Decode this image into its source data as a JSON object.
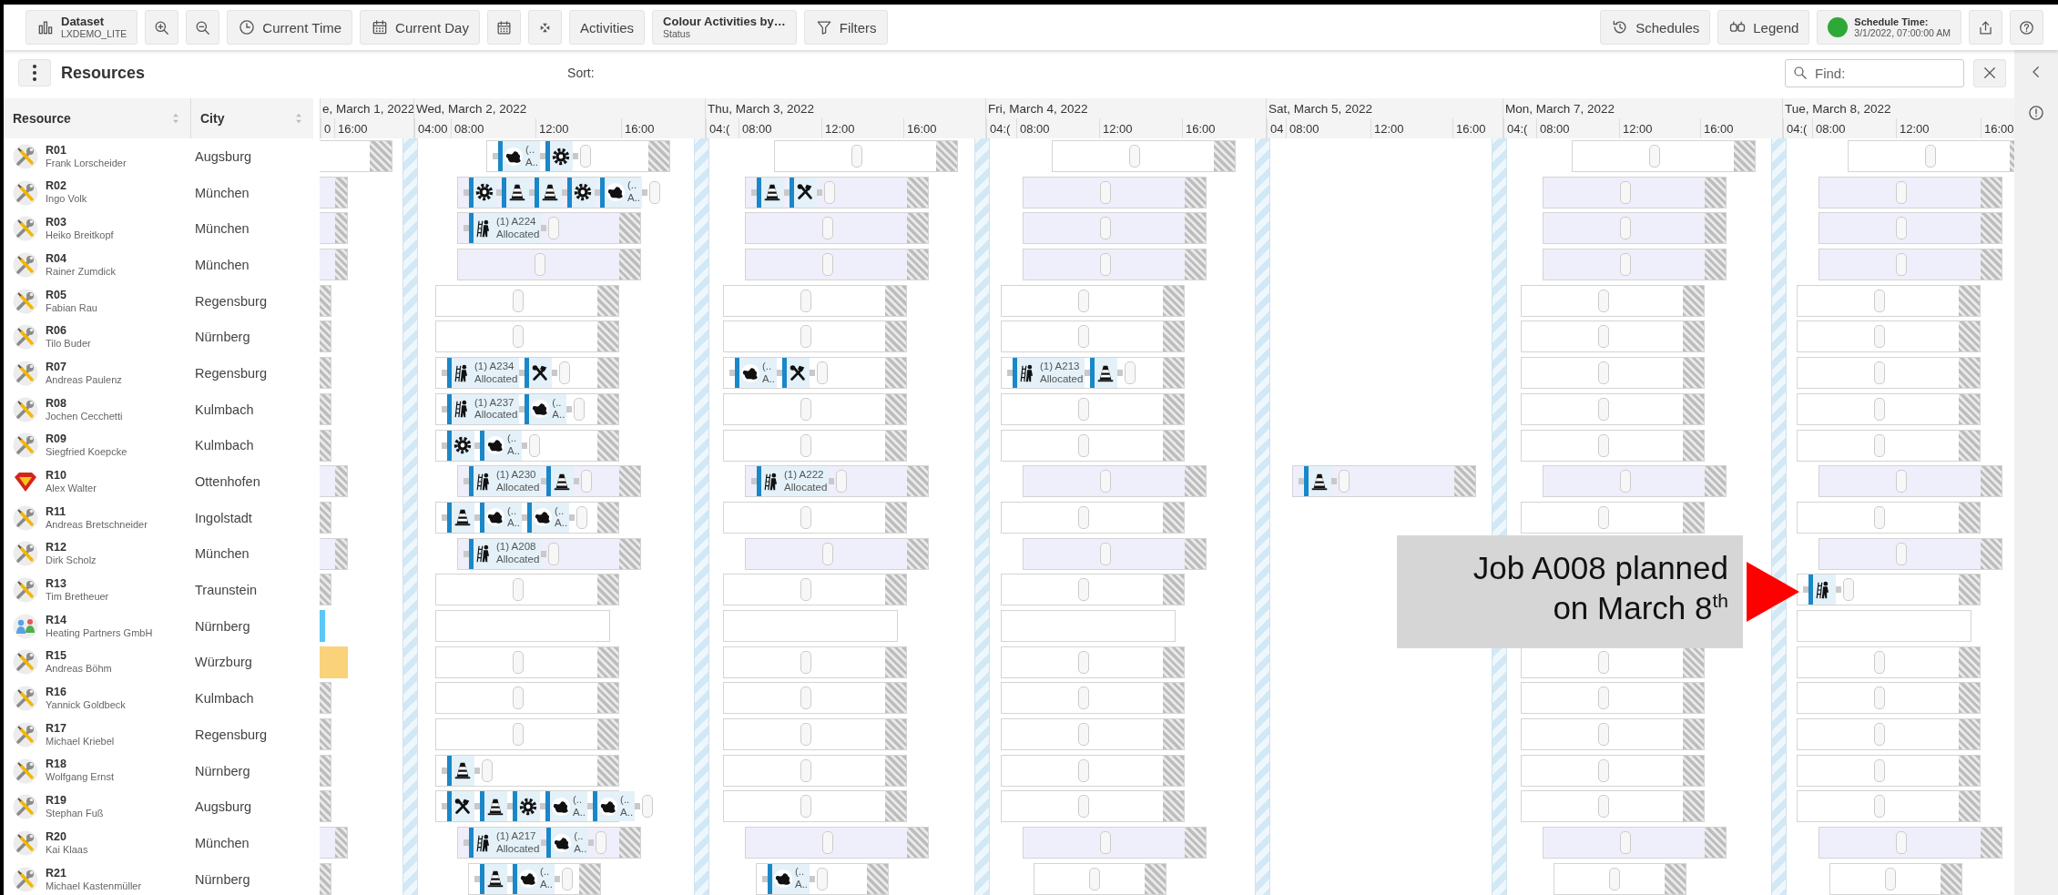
{
  "toolbar": {
    "left": [
      {
        "label": "Dataset",
        "sublabel": "LXDEMO_LITE"
      },
      {
        "label": "Current Time"
      },
      {
        "label": "Current Day"
      },
      {
        "label": "Activities"
      },
      {
        "label": "Colour Activities by…",
        "sublabel": "Status"
      },
      {
        "label": "Filters"
      }
    ],
    "right": [
      {
        "label": "Schedules"
      },
      {
        "label": "Legend"
      }
    ],
    "schedule_time": {
      "label": "Schedule Time:",
      "value": "3/1/2022, 07:00:00 AM",
      "ok": true
    }
  },
  "panel": {
    "title": "Resources",
    "sort_label": "Sort:",
    "find": {
      "placeholder": "Find:"
    }
  },
  "table": {
    "columns": [
      "Resource",
      "City"
    ]
  },
  "timeline": {
    "days": [
      {
        "label": "e, March 1, 2022",
        "ticks": [
          "0",
          "16:00"
        ]
      },
      {
        "label": "Wed, March 2, 2022",
        "ticks": [
          "04:00",
          "08:00",
          "12:00",
          "16:00"
        ]
      },
      {
        "label": "Thu, March 3, 2022",
        "ticks": [
          "04:(",
          "08:00",
          "12:00",
          "16:00"
        ]
      },
      {
        "label": "Fri, March 4, 2022",
        "ticks": [
          "04:(",
          "08:00",
          "12:00",
          "16:00"
        ]
      },
      {
        "label": "Sat, March 5, 2022",
        "ticks": [
          "04",
          "08:00",
          "12:00",
          "16:00"
        ]
      },
      {
        "label": "Mon, March 7, 2022",
        "ticks": [
          "04:(",
          "08:00",
          "12:00",
          "16:00"
        ]
      },
      {
        "label": "Tue, March 8, 2022",
        "ticks": [
          "04:(",
          "08:00",
          "12:00",
          "16:00"
        ]
      }
    ]
  },
  "rows": [
    {
      "id": "R01",
      "name": "Frank Lorscheider",
      "city": "Augsburg",
      "kind": "technician",
      "lead": {
        "kind": "late"
      },
      "days": [
        {
          "kind": "late",
          "activities": [
            {
              "kind": "blob",
              "lines": [
                "(..",
                "A.."
              ]
            },
            {
              "kind": "gear"
            }
          ]
        },
        {
          "kind": "late"
        },
        {
          "kind": "late"
        },
        {
          "kind": "none"
        },
        {
          "kind": "late"
        },
        {
          "kind": "late"
        }
      ]
    },
    {
      "id": "R02",
      "name": "Ingo Volk",
      "city": "München",
      "kind": "technician",
      "lead": {
        "kind": "extended"
      },
      "days": [
        {
          "kind": "extended",
          "activities": [
            {
              "kind": "gear"
            },
            {
              "kind": "cone"
            },
            {
              "kind": "cone"
            },
            {
              "kind": "gear"
            },
            {
              "kind": "blob",
              "lines": [
                "(..",
                "A.."
              ]
            }
          ]
        },
        {
          "kind": "extended",
          "activities": [
            {
              "kind": "cone"
            },
            {
              "kind": "tools"
            }
          ]
        },
        {
          "kind": "extended"
        },
        {
          "kind": "none"
        },
        {
          "kind": "extended"
        },
        {
          "kind": "extended"
        }
      ]
    },
    {
      "id": "R03",
      "name": "Heiko Breitkopf",
      "city": "München",
      "kind": "technician",
      "lead": {
        "kind": "extended"
      },
      "days": [
        {
          "kind": "extended",
          "activities": [
            {
              "kind": "worker",
              "lines": [
                "(1) A224",
                "Allocated"
              ]
            }
          ]
        },
        {
          "kind": "extended"
        },
        {
          "kind": "extended"
        },
        {
          "kind": "none"
        },
        {
          "kind": "extended"
        },
        {
          "kind": "extended"
        }
      ]
    },
    {
      "id": "R04",
      "name": "Rainer Zumdick",
      "city": "München",
      "kind": "technician",
      "lead": {
        "kind": "extended"
      },
      "days": [
        {
          "kind": "extended"
        },
        {
          "kind": "extended"
        },
        {
          "kind": "extended"
        },
        {
          "kind": "none"
        },
        {
          "kind": "extended"
        },
        {
          "kind": "extended"
        }
      ]
    },
    {
      "id": "R05",
      "name": "Fabian Rau",
      "city": "Regensburg",
      "kind": "technician",
      "lead": {
        "kind": "standard"
      },
      "days": [
        {
          "kind": "standard"
        },
        {
          "kind": "standard"
        },
        {
          "kind": "standard"
        },
        {
          "kind": "none"
        },
        {
          "kind": "standard"
        },
        {
          "kind": "standard"
        }
      ]
    },
    {
      "id": "R06",
      "name": "Tilo Buder",
      "city": "Nürnberg",
      "kind": "technician",
      "lead": {
        "kind": "standard"
      },
      "days": [
        {
          "kind": "standard"
        },
        {
          "kind": "standard"
        },
        {
          "kind": "standard"
        },
        {
          "kind": "none"
        },
        {
          "kind": "standard"
        },
        {
          "kind": "standard"
        }
      ]
    },
    {
      "id": "R07",
      "name": "Andreas Paulenz",
      "city": "Regensburg",
      "kind": "technician",
      "lead": {
        "kind": "standard"
      },
      "days": [
        {
          "kind": "standard",
          "activities": [
            {
              "kind": "worker",
              "lines": [
                "(1) A234",
                "Allocated"
              ]
            },
            {
              "kind": "tools"
            }
          ]
        },
        {
          "kind": "standard",
          "activities": [
            {
              "kind": "blob",
              "lines": [
                "(..",
                "A.."
              ]
            },
            {
              "kind": "tools"
            }
          ]
        },
        {
          "kind": "standard",
          "activities": [
            {
              "kind": "worker",
              "lines": [
                "(1) A213",
                "Allocated"
              ]
            },
            {
              "kind": "cone"
            }
          ]
        },
        {
          "kind": "none"
        },
        {
          "kind": "standard"
        },
        {
          "kind": "standard"
        }
      ]
    },
    {
      "id": "R08",
      "name": "Jochen Cecchetti",
      "city": "Kulmbach",
      "kind": "technician",
      "lead": {
        "kind": "standard"
      },
      "days": [
        {
          "kind": "standard",
          "activities": [
            {
              "kind": "worker",
              "lines": [
                "(1) A237",
                "Allocated"
              ]
            },
            {
              "kind": "blob",
              "lines": [
                "(..",
                "A.."
              ]
            }
          ]
        },
        {
          "kind": "standard"
        },
        {
          "kind": "standard"
        },
        {
          "kind": "none"
        },
        {
          "kind": "standard"
        },
        {
          "kind": "standard"
        }
      ]
    },
    {
      "id": "R09",
      "name": "Siegfried Koepcke",
      "city": "Kulmbach",
      "kind": "technician",
      "lead": {
        "kind": "standard"
      },
      "days": [
        {
          "kind": "standard",
          "activities": [
            {
              "kind": "gear"
            },
            {
              "kind": "blob",
              "lines": [
                "(..",
                "A.."
              ]
            }
          ]
        },
        {
          "kind": "standard"
        },
        {
          "kind": "standard"
        },
        {
          "kind": "none"
        },
        {
          "kind": "standard"
        },
        {
          "kind": "standard"
        }
      ]
    },
    {
      "id": "R10",
      "name": "Alex Walter",
      "city": "Ottenhofen",
      "kind": "hero",
      "lead": {
        "kind": "extended"
      },
      "days": [
        {
          "kind": "extended",
          "activities": [
            {
              "kind": "worker",
              "lines": [
                "(1) A230",
                "Allocated"
              ]
            },
            {
              "kind": "cone"
            }
          ]
        },
        {
          "kind": "extended",
          "activities": [
            {
              "kind": "worker",
              "lines": [
                "(1) A222",
                "Allocated"
              ]
            }
          ]
        },
        {
          "kind": "extended"
        },
        {
          "kind": "extended",
          "activities": [
            {
              "kind": "cone"
            }
          ]
        },
        {
          "kind": "extended"
        },
        {
          "kind": "extended"
        }
      ]
    },
    {
      "id": "R11",
      "name": "Andreas Bretschneider",
      "city": "Ingolstadt",
      "kind": "technician",
      "lead": {
        "kind": "standard"
      },
      "days": [
        {
          "kind": "standard",
          "activities": [
            {
              "kind": "cone"
            },
            {
              "kind": "blob",
              "lines": [
                "(..",
                "A.."
              ]
            },
            {
              "kind": "blob",
              "lines": [
                "(..",
                "A.."
              ]
            }
          ]
        },
        {
          "kind": "standard"
        },
        {
          "kind": "standard"
        },
        {
          "kind": "none"
        },
        {
          "kind": "standard"
        },
        {
          "kind": "standard"
        }
      ]
    },
    {
      "id": "R12",
      "name": "Dirk Scholz",
      "city": "München",
      "kind": "technician",
      "lead": {
        "kind": "extended"
      },
      "days": [
        {
          "kind": "extended",
          "activities": [
            {
              "kind": "worker",
              "lines": [
                "(1) A208",
                "Allocated"
              ]
            }
          ]
        },
        {
          "kind": "extended"
        },
        {
          "kind": "extended"
        },
        {
          "kind": "none"
        },
        {
          "kind": "none"
        },
        {
          "kind": "extended"
        }
      ]
    },
    {
      "id": "R13",
      "name": "Tim Bretheuer",
      "city": "Traunstein",
      "kind": "technician",
      "lead": {
        "kind": "standard"
      },
      "days": [
        {
          "kind": "standard"
        },
        {
          "kind": "standard"
        },
        {
          "kind": "standard"
        },
        {
          "kind": "none"
        },
        {
          "kind": "none"
        },
        {
          "kind": "standard",
          "activities": [
            {
              "kind": "worker"
            }
          ]
        }
      ]
    },
    {
      "id": "R14",
      "name": "Heating Partners GmbH",
      "city": "Nürnberg",
      "kind": "team",
      "lead": {
        "kind": "sliver",
        "color": "#5bc8f5"
      },
      "days": [
        {
          "kind": "open"
        },
        {
          "kind": "open"
        },
        {
          "kind": "open"
        },
        {
          "kind": "none"
        },
        {
          "kind": "none"
        },
        {
          "kind": "open"
        }
      ]
    },
    {
      "id": "R15",
      "name": "Andreas Böhm",
      "city": "Würzburg",
      "kind": "technician",
      "lead": {
        "kind": "block",
        "color": "#f9d27a"
      },
      "days": [
        {
          "kind": "standard"
        },
        {
          "kind": "standard"
        },
        {
          "kind": "standard"
        },
        {
          "kind": "none"
        },
        {
          "kind": "standard"
        },
        {
          "kind": "standard"
        }
      ]
    },
    {
      "id": "R16",
      "name": "Yannick Goldbeck",
      "city": "Kulmbach",
      "kind": "technician",
      "lead": {
        "kind": "standard"
      },
      "days": [
        {
          "kind": "standard"
        },
        {
          "kind": "standard"
        },
        {
          "kind": "standard"
        },
        {
          "kind": "none"
        },
        {
          "kind": "standard"
        },
        {
          "kind": "standard"
        }
      ]
    },
    {
      "id": "R17",
      "name": "Michael Kriebel",
      "city": "Regensburg",
      "kind": "technician",
      "lead": {
        "kind": "standard"
      },
      "days": [
        {
          "kind": "standard"
        },
        {
          "kind": "standard"
        },
        {
          "kind": "standard"
        },
        {
          "kind": "none"
        },
        {
          "kind": "standard"
        },
        {
          "kind": "standard"
        }
      ]
    },
    {
      "id": "R18",
      "name": "Wolfgang Ernst",
      "city": "Nürnberg",
      "kind": "technician",
      "lead": {
        "kind": "standard"
      },
      "days": [
        {
          "kind": "standard",
          "activities": [
            {
              "kind": "cone"
            }
          ]
        },
        {
          "kind": "standard"
        },
        {
          "kind": "standard"
        },
        {
          "kind": "none"
        },
        {
          "kind": "standard"
        },
        {
          "kind": "standard"
        }
      ]
    },
    {
      "id": "R19",
      "name": "Stephan Fuß",
      "city": "Augsburg",
      "kind": "technician",
      "lead": {
        "kind": "standard"
      },
      "days": [
        {
          "kind": "standard",
          "activities": [
            {
              "kind": "tools"
            },
            {
              "kind": "cone"
            },
            {
              "kind": "gear"
            },
            {
              "kind": "blob",
              "lines": [
                "(..",
                "A.."
              ]
            },
            {
              "kind": "blob",
              "lines": [
                "(..",
                "A.."
              ]
            }
          ]
        },
        {
          "kind": "standard"
        },
        {
          "kind": "standard"
        },
        {
          "kind": "none"
        },
        {
          "kind": "standard"
        },
        {
          "kind": "standard"
        }
      ]
    },
    {
      "id": "R20",
      "name": "Kai Klaas",
      "city": "München",
      "kind": "technician",
      "lead": {
        "kind": "extended"
      },
      "days": [
        {
          "kind": "extended",
          "activities": [
            {
              "kind": "worker",
              "lines": [
                "(1) A217",
                "Allocated"
              ]
            },
            {
              "kind": "blob",
              "lines": [
                "(..",
                "A.."
              ]
            }
          ]
        },
        {
          "kind": "extended"
        },
        {
          "kind": "extended"
        },
        {
          "kind": "none"
        },
        {
          "kind": "extended"
        },
        {
          "kind": "extended"
        }
      ]
    },
    {
      "id": "R21",
      "name": "Michael Kastenmüller",
      "city": "Nürnberg",
      "kind": "technician",
      "lead": {
        "kind": "standard"
      },
      "days": [
        {
          "kind": "partial",
          "activities": [
            {
              "kind": "cone"
            },
            {
              "kind": "blob",
              "lines": [
                "(..",
                "A.."
              ]
            }
          ]
        },
        {
          "kind": "partial",
          "activities": [
            {
              "kind": "blob",
              "lines": [
                "(..",
                "A.."
              ]
            }
          ]
        },
        {
          "kind": "partial"
        },
        {
          "kind": "none"
        },
        {
          "kind": "partial"
        },
        {
          "kind": "partial"
        }
      ]
    }
  ],
  "annotation": {
    "lines": [
      "Job A008 planned",
      "on March 8$^{th}$"
    ]
  }
}
